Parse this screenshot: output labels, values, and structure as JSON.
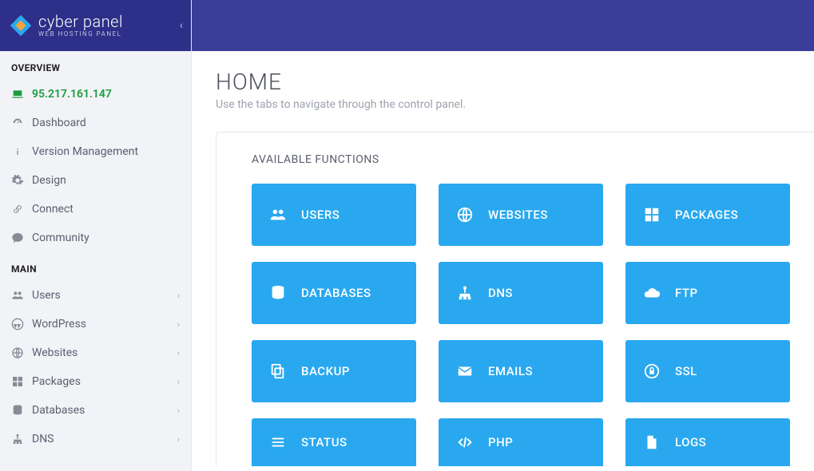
{
  "brand": {
    "name": "cyber panel",
    "sub": "WEB HOSTING PANEL"
  },
  "sidebar": {
    "overview_title": "OVERVIEW",
    "main_title": "MAIN",
    "overview_items": [
      {
        "label": "95.217.161.147",
        "icon": "laptop",
        "ip": true
      },
      {
        "label": "Dashboard",
        "icon": "gauge"
      },
      {
        "label": "Version Management",
        "icon": "info"
      },
      {
        "label": "Design",
        "icon": "gear"
      },
      {
        "label": "Connect",
        "icon": "link"
      },
      {
        "label": "Community",
        "icon": "chat"
      }
    ],
    "main_items": [
      {
        "label": "Users",
        "icon": "users"
      },
      {
        "label": "WordPress",
        "icon": "wordpress"
      },
      {
        "label": "Websites",
        "icon": "globe"
      },
      {
        "label": "Packages",
        "icon": "boxes"
      },
      {
        "label": "Databases",
        "icon": "database"
      },
      {
        "label": "DNS",
        "icon": "sitemap"
      }
    ]
  },
  "page": {
    "title": "HOME",
    "subtitle": "Use the tabs to navigate through the control panel."
  },
  "panel": {
    "title": "AVAILABLE FUNCTIONS",
    "cards": [
      {
        "label": "USERS",
        "icon": "users"
      },
      {
        "label": "WEBSITES",
        "icon": "globe"
      },
      {
        "label": "PACKAGES",
        "icon": "boxes"
      },
      {
        "label": "DATABASES",
        "icon": "database"
      },
      {
        "label": "DNS",
        "icon": "sitemap"
      },
      {
        "label": "FTP",
        "icon": "cloud"
      },
      {
        "label": "BACKUP",
        "icon": "copy"
      },
      {
        "label": "EMAILS",
        "icon": "mail"
      },
      {
        "label": "SSL",
        "icon": "lock"
      },
      {
        "label": "STATUS",
        "icon": "list"
      },
      {
        "label": "PHP",
        "icon": "code"
      },
      {
        "label": "LOGS",
        "icon": "file"
      }
    ]
  }
}
